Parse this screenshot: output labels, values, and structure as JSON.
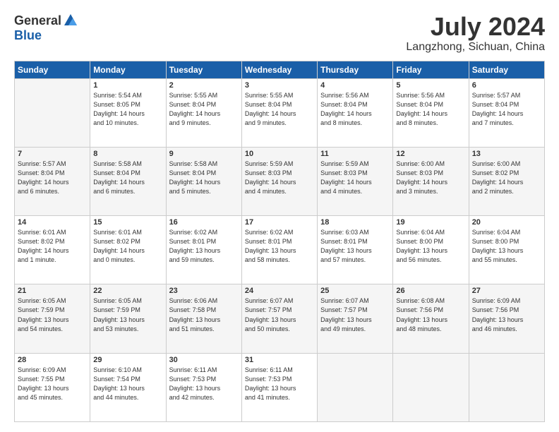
{
  "logo": {
    "general": "General",
    "blue": "Blue"
  },
  "header": {
    "month": "July 2024",
    "location": "Langzhong, Sichuan, China"
  },
  "weekdays": [
    "Sunday",
    "Monday",
    "Tuesday",
    "Wednesday",
    "Thursday",
    "Friday",
    "Saturday"
  ],
  "weeks": [
    [
      {
        "day": "",
        "info": ""
      },
      {
        "day": "1",
        "info": "Sunrise: 5:54 AM\nSunset: 8:05 PM\nDaylight: 14 hours\nand 10 minutes."
      },
      {
        "day": "2",
        "info": "Sunrise: 5:55 AM\nSunset: 8:04 PM\nDaylight: 14 hours\nand 9 minutes."
      },
      {
        "day": "3",
        "info": "Sunrise: 5:55 AM\nSunset: 8:04 PM\nDaylight: 14 hours\nand 9 minutes."
      },
      {
        "day": "4",
        "info": "Sunrise: 5:56 AM\nSunset: 8:04 PM\nDaylight: 14 hours\nand 8 minutes."
      },
      {
        "day": "5",
        "info": "Sunrise: 5:56 AM\nSunset: 8:04 PM\nDaylight: 14 hours\nand 8 minutes."
      },
      {
        "day": "6",
        "info": "Sunrise: 5:57 AM\nSunset: 8:04 PM\nDaylight: 14 hours\nand 7 minutes."
      }
    ],
    [
      {
        "day": "7",
        "info": "Sunrise: 5:57 AM\nSunset: 8:04 PM\nDaylight: 14 hours\nand 6 minutes."
      },
      {
        "day": "8",
        "info": "Sunrise: 5:58 AM\nSunset: 8:04 PM\nDaylight: 14 hours\nand 6 minutes."
      },
      {
        "day": "9",
        "info": "Sunrise: 5:58 AM\nSunset: 8:04 PM\nDaylight: 14 hours\nand 5 minutes."
      },
      {
        "day": "10",
        "info": "Sunrise: 5:59 AM\nSunset: 8:03 PM\nDaylight: 14 hours\nand 4 minutes."
      },
      {
        "day": "11",
        "info": "Sunrise: 5:59 AM\nSunset: 8:03 PM\nDaylight: 14 hours\nand 4 minutes."
      },
      {
        "day": "12",
        "info": "Sunrise: 6:00 AM\nSunset: 8:03 PM\nDaylight: 14 hours\nand 3 minutes."
      },
      {
        "day": "13",
        "info": "Sunrise: 6:00 AM\nSunset: 8:02 PM\nDaylight: 14 hours\nand 2 minutes."
      }
    ],
    [
      {
        "day": "14",
        "info": "Sunrise: 6:01 AM\nSunset: 8:02 PM\nDaylight: 14 hours\nand 1 minute."
      },
      {
        "day": "15",
        "info": "Sunrise: 6:01 AM\nSunset: 8:02 PM\nDaylight: 14 hours\nand 0 minutes."
      },
      {
        "day": "16",
        "info": "Sunrise: 6:02 AM\nSunset: 8:01 PM\nDaylight: 13 hours\nand 59 minutes."
      },
      {
        "day": "17",
        "info": "Sunrise: 6:02 AM\nSunset: 8:01 PM\nDaylight: 13 hours\nand 58 minutes."
      },
      {
        "day": "18",
        "info": "Sunrise: 6:03 AM\nSunset: 8:01 PM\nDaylight: 13 hours\nand 57 minutes."
      },
      {
        "day": "19",
        "info": "Sunrise: 6:04 AM\nSunset: 8:00 PM\nDaylight: 13 hours\nand 56 minutes."
      },
      {
        "day": "20",
        "info": "Sunrise: 6:04 AM\nSunset: 8:00 PM\nDaylight: 13 hours\nand 55 minutes."
      }
    ],
    [
      {
        "day": "21",
        "info": "Sunrise: 6:05 AM\nSunset: 7:59 PM\nDaylight: 13 hours\nand 54 minutes."
      },
      {
        "day": "22",
        "info": "Sunrise: 6:05 AM\nSunset: 7:59 PM\nDaylight: 13 hours\nand 53 minutes."
      },
      {
        "day": "23",
        "info": "Sunrise: 6:06 AM\nSunset: 7:58 PM\nDaylight: 13 hours\nand 51 minutes."
      },
      {
        "day": "24",
        "info": "Sunrise: 6:07 AM\nSunset: 7:57 PM\nDaylight: 13 hours\nand 50 minutes."
      },
      {
        "day": "25",
        "info": "Sunrise: 6:07 AM\nSunset: 7:57 PM\nDaylight: 13 hours\nand 49 minutes."
      },
      {
        "day": "26",
        "info": "Sunrise: 6:08 AM\nSunset: 7:56 PM\nDaylight: 13 hours\nand 48 minutes."
      },
      {
        "day": "27",
        "info": "Sunrise: 6:09 AM\nSunset: 7:56 PM\nDaylight: 13 hours\nand 46 minutes."
      }
    ],
    [
      {
        "day": "28",
        "info": "Sunrise: 6:09 AM\nSunset: 7:55 PM\nDaylight: 13 hours\nand 45 minutes."
      },
      {
        "day": "29",
        "info": "Sunrise: 6:10 AM\nSunset: 7:54 PM\nDaylight: 13 hours\nand 44 minutes."
      },
      {
        "day": "30",
        "info": "Sunrise: 6:11 AM\nSunset: 7:53 PM\nDaylight: 13 hours\nand 42 minutes."
      },
      {
        "day": "31",
        "info": "Sunrise: 6:11 AM\nSunset: 7:53 PM\nDaylight: 13 hours\nand 41 minutes."
      },
      {
        "day": "",
        "info": ""
      },
      {
        "day": "",
        "info": ""
      },
      {
        "day": "",
        "info": ""
      }
    ]
  ]
}
